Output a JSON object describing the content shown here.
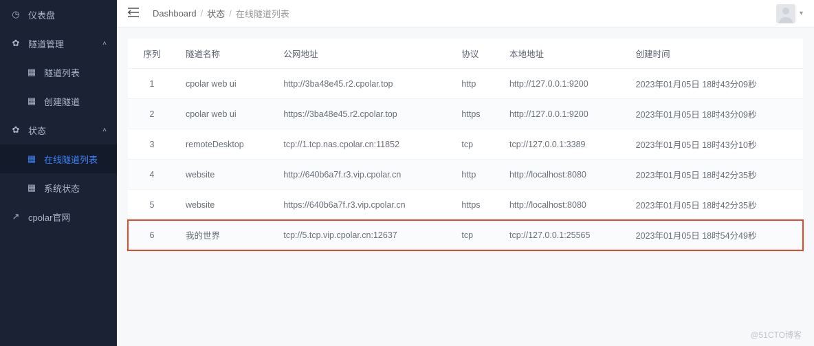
{
  "sidebar": {
    "items": [
      {
        "label": "仪表盘",
        "icon": "dashboard"
      },
      {
        "label": "隧道管理",
        "icon": "cog",
        "expandable": true
      },
      {
        "label": "隧道列表",
        "icon": "grid",
        "sub": true
      },
      {
        "label": "创建隧道",
        "icon": "grid",
        "sub": true
      },
      {
        "label": "状态",
        "icon": "cog",
        "expandable": true
      },
      {
        "label": "在线隧道列表",
        "icon": "grid",
        "sub": true,
        "active": true
      },
      {
        "label": "系统状态",
        "icon": "grid",
        "sub": true
      },
      {
        "label": "cpolar官网",
        "icon": "external"
      }
    ]
  },
  "breadcrumb": {
    "root": "Dashboard",
    "mid": "状态",
    "current": "在线隧道列表"
  },
  "table": {
    "columns": {
      "seq": "序列",
      "name": "隧道名称",
      "public": "公网地址",
      "proto": "协议",
      "local": "本地地址",
      "created": "创建时间"
    },
    "rows": [
      {
        "seq": "1",
        "name": "cpolar web ui",
        "public": "http://3ba48e45.r2.cpolar.top",
        "proto": "http",
        "local": "http://127.0.0.1:9200",
        "created": "2023年01月05日 18时43分09秒"
      },
      {
        "seq": "2",
        "name": "cpolar web ui",
        "public": "https://3ba48e45.r2.cpolar.top",
        "proto": "https",
        "local": "http://127.0.0.1:9200",
        "created": "2023年01月05日 18时43分09秒"
      },
      {
        "seq": "3",
        "name": "remoteDesktop",
        "public": "tcp://1.tcp.nas.cpolar.cn:11852",
        "proto": "tcp",
        "local": "tcp://127.0.0.1:3389",
        "created": "2023年01月05日 18时43分10秒"
      },
      {
        "seq": "4",
        "name": "website",
        "public": "http://640b6a7f.r3.vip.cpolar.cn",
        "proto": "http",
        "local": "http://localhost:8080",
        "created": "2023年01月05日 18时42分35秒"
      },
      {
        "seq": "5",
        "name": "website",
        "public": "https://640b6a7f.r3.vip.cpolar.cn",
        "proto": "https",
        "local": "http://localhost:8080",
        "created": "2023年01月05日 18时42分35秒"
      },
      {
        "seq": "6",
        "name": "我的世界",
        "public": "tcp://5.tcp.vip.cpolar.cn:12637",
        "proto": "tcp",
        "local": "tcp://127.0.0.1:25565",
        "created": "2023年01月05日 18时54分49秒",
        "highlight": true
      }
    ]
  },
  "watermark": "@51CTO博客"
}
